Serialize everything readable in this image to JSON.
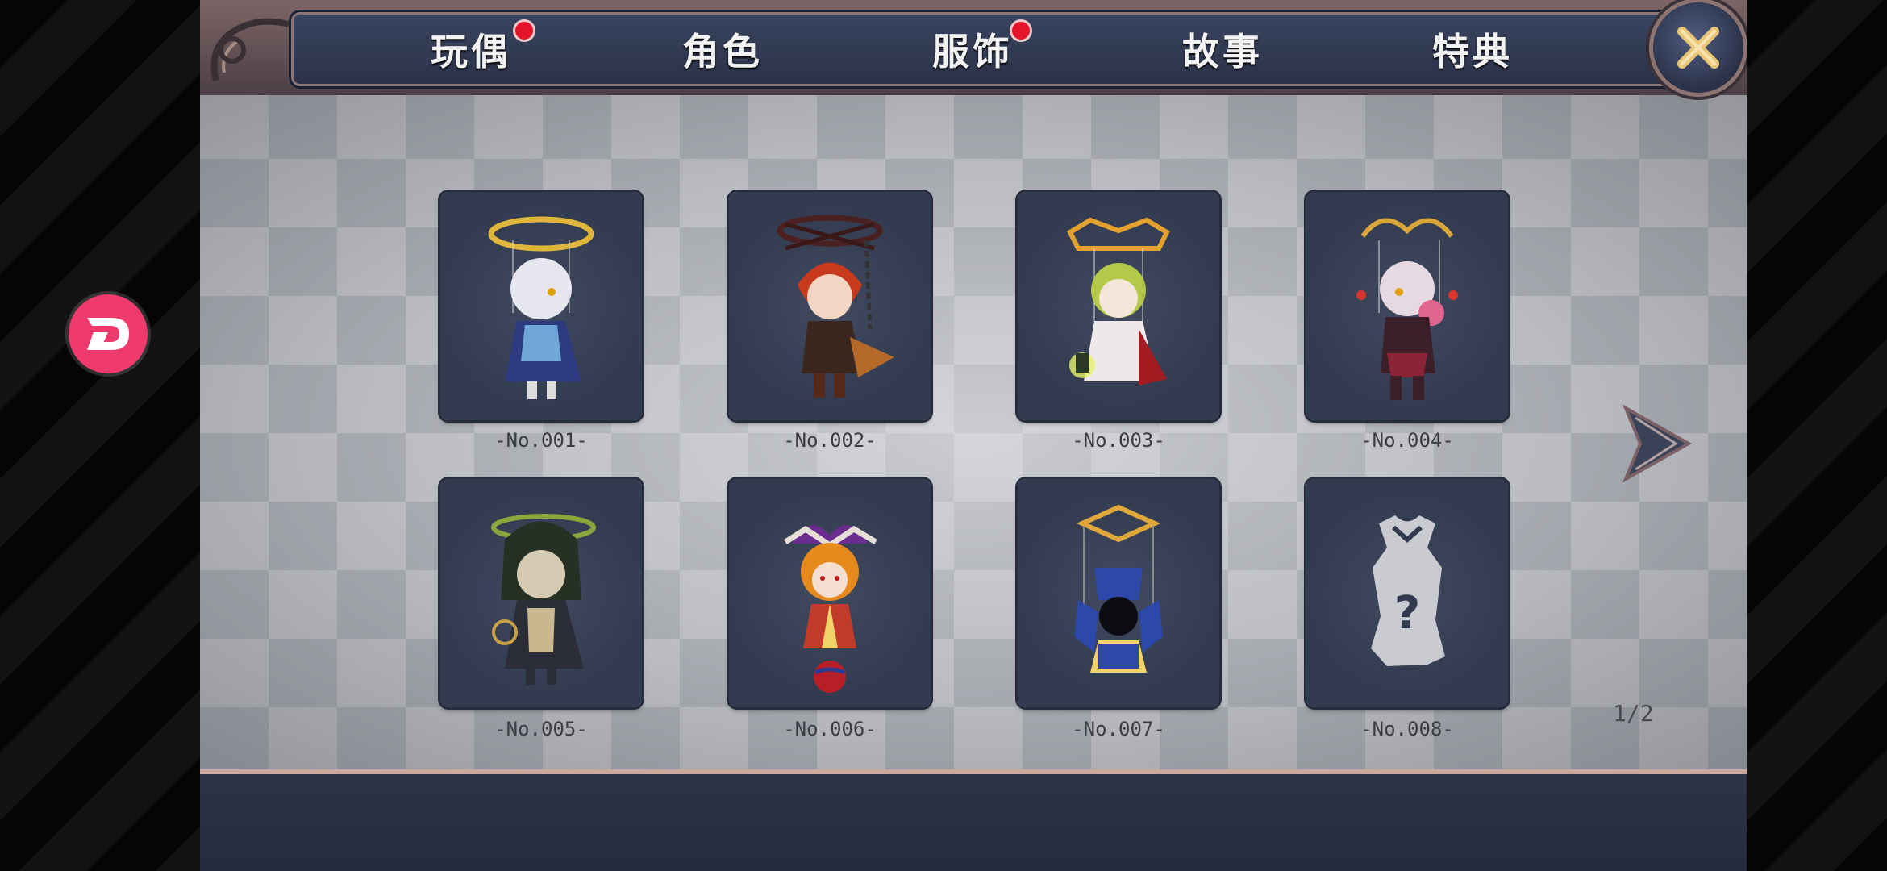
{
  "tabs": [
    {
      "label": "玩偶",
      "badge": true
    },
    {
      "label": "角色",
      "badge": false
    },
    {
      "label": "服饰",
      "badge": true
    },
    {
      "label": "故事",
      "badge": false
    },
    {
      "label": "特典",
      "badge": false
    }
  ],
  "dolls": [
    {
      "label": "-No.001-",
      "icon": "white-haired-doll-icon",
      "locked": false
    },
    {
      "label": "-No.002-",
      "icon": "red-haired-doll-icon",
      "locked": false
    },
    {
      "label": "-No.003-",
      "icon": "green-haired-doll-icon",
      "locked": false
    },
    {
      "label": "-No.004-",
      "icon": "pink-haired-doll-icon",
      "locked": false
    },
    {
      "label": "-No.005-",
      "icon": "hooded-doll-icon",
      "locked": false
    },
    {
      "label": "-No.006-",
      "icon": "jester-doll-icon",
      "locked": false
    },
    {
      "label": "-No.007-",
      "icon": "cage-doll-icon",
      "locked": false
    },
    {
      "label": "-No.008-",
      "icon": "locked-doll-icon",
      "locked": true
    }
  ],
  "pagination": {
    "text": "1/2"
  },
  "colors": {
    "badge": "#e3142b",
    "tab_bar": "#2a3148",
    "card": "#323a4f",
    "floating_button": "#ee3a6d"
  }
}
